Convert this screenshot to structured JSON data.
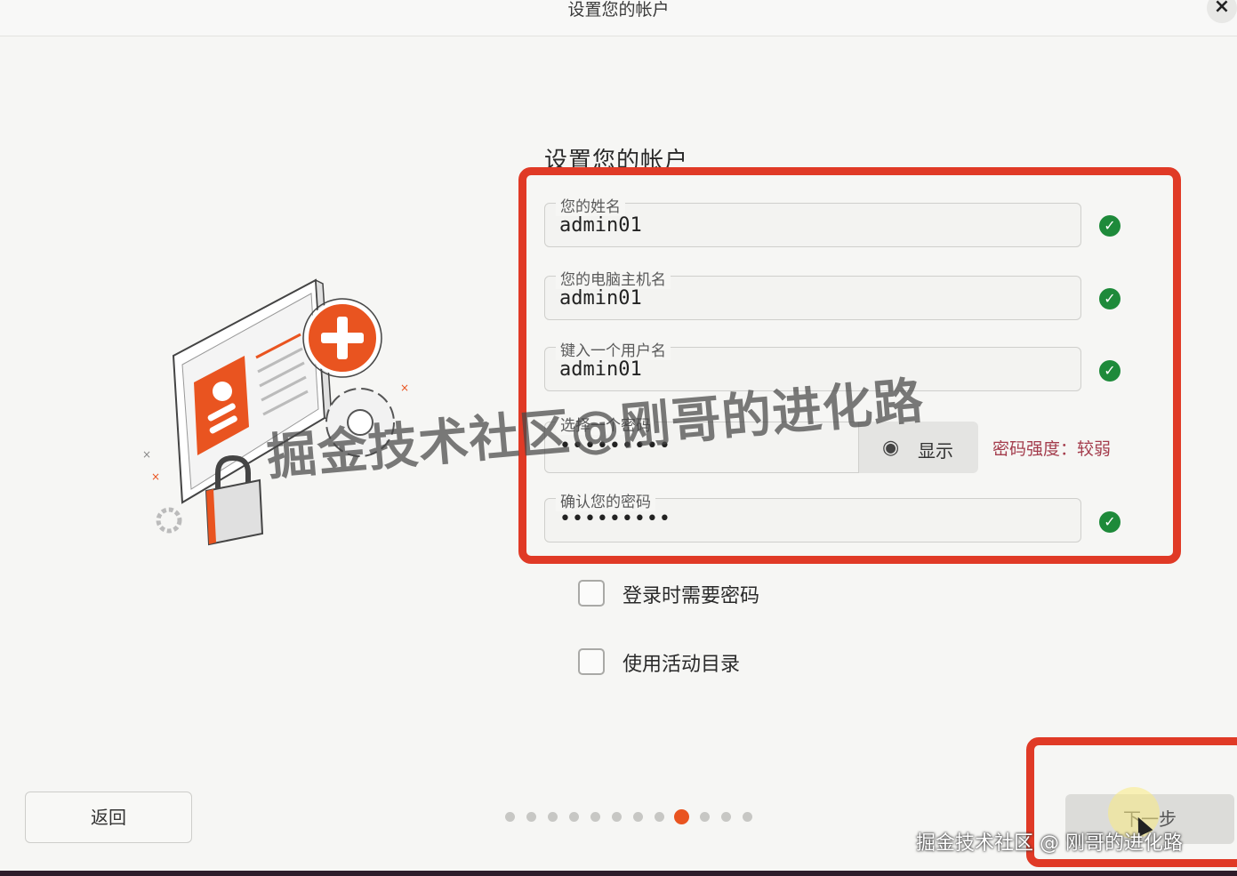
{
  "window": {
    "title": "设置您的帐户",
    "close_label": "×"
  },
  "page": {
    "heading": "设置您的帐户"
  },
  "form": {
    "name": {
      "label": "您的姓名",
      "value": "admin01",
      "valid": true
    },
    "hostname": {
      "label": "您的电脑主机名",
      "value": "admin01",
      "valid": true
    },
    "username": {
      "label": "键入一个用户名",
      "value": "admin01",
      "valid": true
    },
    "password": {
      "label": "选择一个密码",
      "value": "•••••••••",
      "show_label": "显示",
      "show_icon": "eye-icon",
      "strength_text": "密码强度：较弱"
    },
    "confirm": {
      "label": "确认您的密码",
      "value": "•••••••••",
      "valid": true
    }
  },
  "options": {
    "require_password": {
      "label": "登录时需要密码",
      "checked": false
    },
    "active_directory": {
      "label": "使用活动目录",
      "checked": false
    }
  },
  "footer": {
    "back_label": "返回",
    "next_label": "下一步",
    "step_current": 9,
    "step_total": 12
  },
  "watermark": {
    "big": "掘金技术社区@刚哥的进化路",
    "small": "掘金技术社区 @ 刚哥的进化路"
  },
  "colors": {
    "accent": "#e95420",
    "valid": "#1e8a3a",
    "highlight": "#e03a26",
    "strength_weak": "#a43d4d"
  }
}
